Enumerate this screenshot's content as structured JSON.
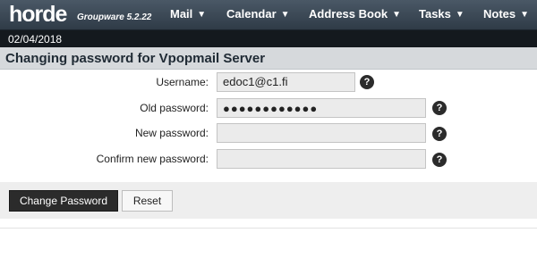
{
  "app": {
    "logo": "horde",
    "subtitle": "Groupware 5.2.22",
    "date": "02/04/2018"
  },
  "nav": {
    "mail": "Mail",
    "calendar": "Calendar",
    "address_book": "Address Book",
    "tasks": "Tasks",
    "notes": "Notes",
    "dropdown_icon": "chevron-down-icon"
  },
  "page": {
    "title": "Changing password for Vpopmail Server"
  },
  "form": {
    "username_label": "Username:",
    "username_value": "edoc1@c1.fi",
    "old_password_label": "Old password:",
    "old_password_value": "●●●●●●●●●●●●",
    "new_password_label": "New password:",
    "new_password_value": "",
    "confirm_password_label": "Confirm new password:",
    "confirm_password_value": "",
    "help_glyph": "?"
  },
  "buttons": {
    "change_password": "Change Password",
    "reset": "Reset"
  }
}
